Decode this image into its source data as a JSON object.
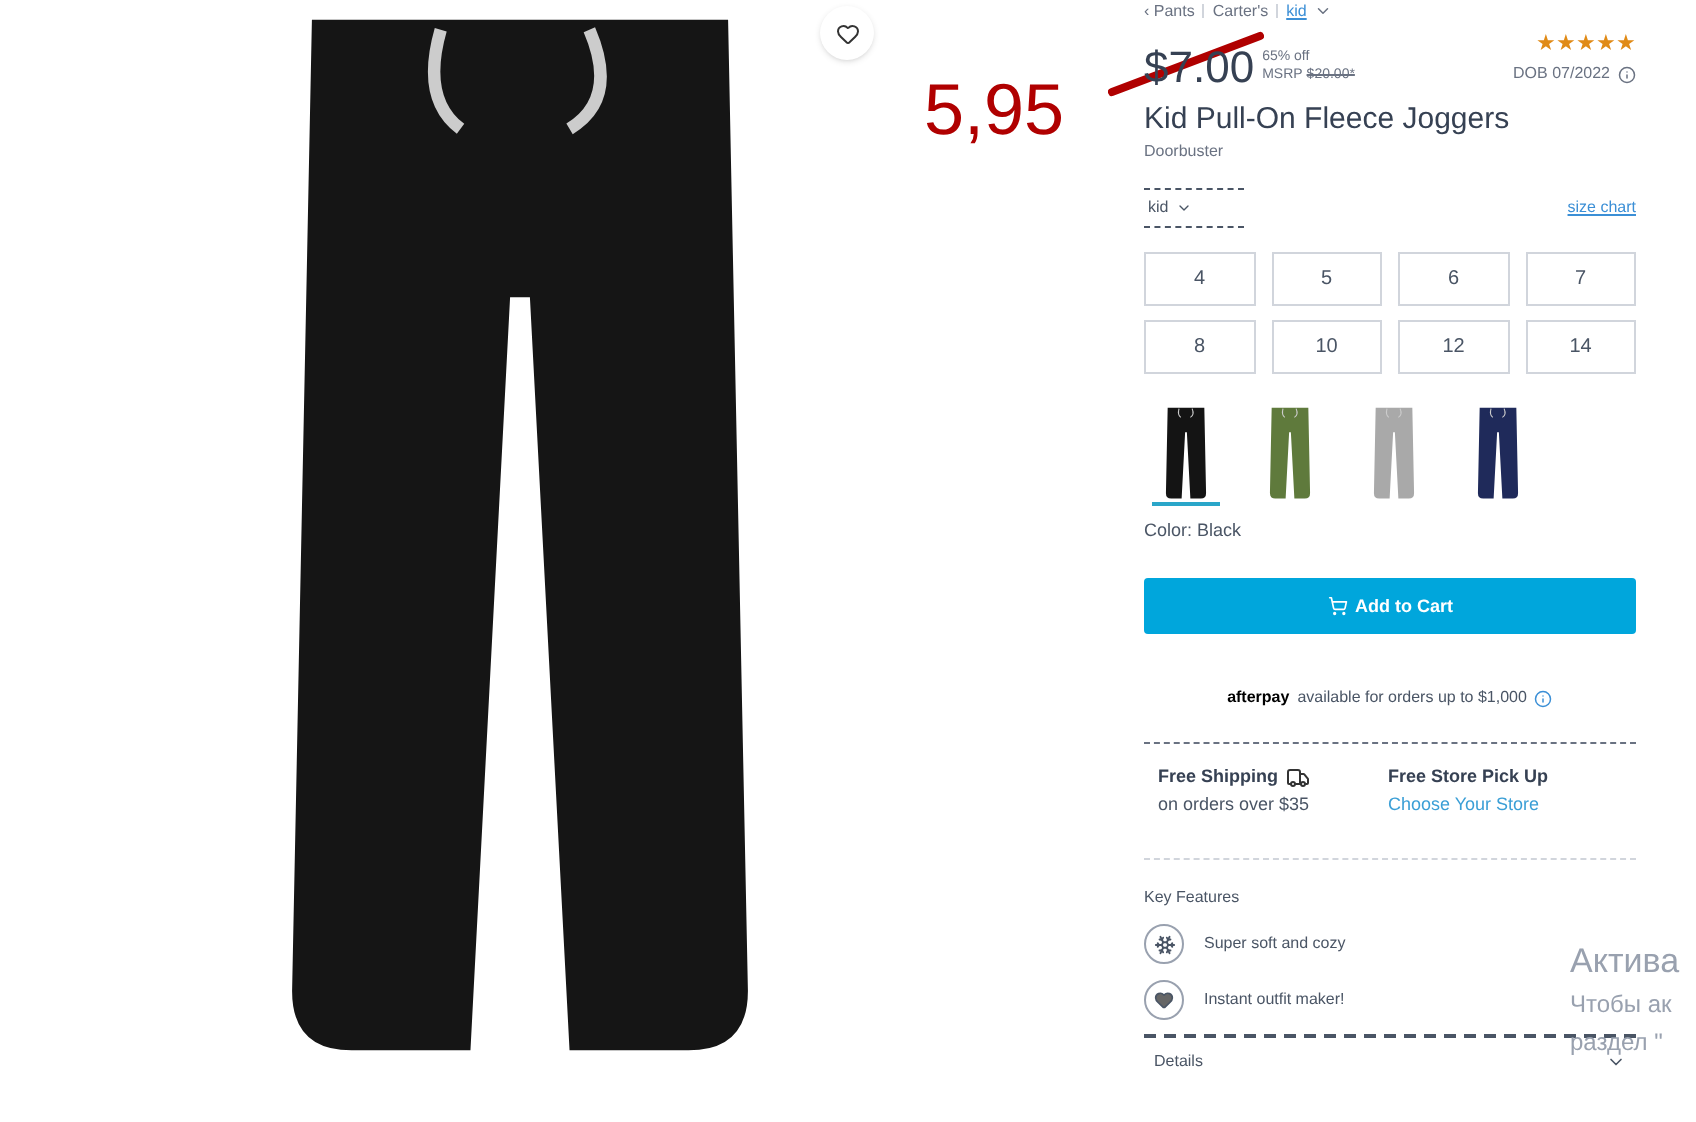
{
  "annotation": {
    "handwritten_price": "5,95",
    "strike_price": true
  },
  "breadcrumb": [
    {
      "label": "‹ Pants",
      "kind": "text"
    },
    {
      "label": "Carter's",
      "kind": "text"
    },
    {
      "label": "kid",
      "kind": "link"
    }
  ],
  "price": {
    "current": "$7.00",
    "discount": "65% off",
    "msrp_label": "MSRP",
    "msrp": "$20.00*"
  },
  "rating": {
    "stars": 5
  },
  "dob": "DOB 07/2022",
  "title": "Kid Pull-On Fleece Joggers",
  "subtitle": "Doorbuster",
  "size_type": "kid",
  "size_chart": "size chart",
  "sizes": [
    {
      "label": "4",
      "selected": false
    },
    {
      "label": "5",
      "selected": false
    },
    {
      "label": "6",
      "selected": false
    },
    {
      "label": "7",
      "selected": false
    },
    {
      "label": "8",
      "selected": false
    },
    {
      "label": "10",
      "selected": false
    },
    {
      "label": "12",
      "selected": false
    },
    {
      "label": "14",
      "selected": false
    }
  ],
  "colors": [
    {
      "selected": true,
      "color": "#141414"
    },
    {
      "selected": false,
      "color": "#5f7a3c"
    },
    {
      "selected": false,
      "color": "#a9a9a9"
    },
    {
      "selected": false,
      "color": "#1f2a5a"
    }
  ],
  "color_label": "Color: Black",
  "add_to_cart": "Add to Cart",
  "afterpay": {
    "brand": "afterpay",
    "text": "available for orders up to $1,000"
  },
  "shipping": {
    "title": "Free Shipping",
    "note": "on orders over $35"
  },
  "pickup": {
    "title": "Free Store Pick Up",
    "link": "Choose Your Store"
  },
  "key_features": {
    "title": "Key Features",
    "items": [
      {
        "kind": "snowflake",
        "label": "Super soft and cozy"
      },
      {
        "kind": "heart",
        "label": "Instant outfit maker!"
      }
    ]
  },
  "details": "Details",
  "activation_notice": [
    "Актива",
    "Чтобы ак",
    "раздел \""
  ]
}
